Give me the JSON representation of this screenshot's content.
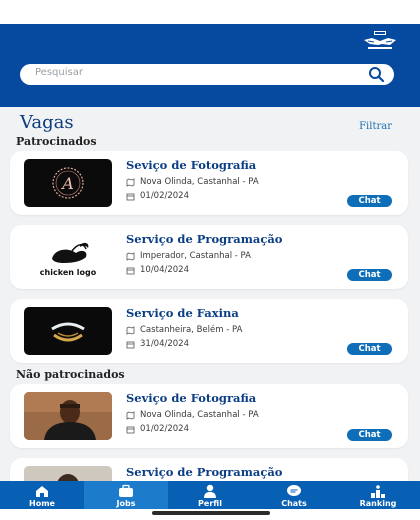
{
  "header": {
    "logo_icon": "handshake-logo-icon"
  },
  "search": {
    "placeholder": "Pesquisar",
    "icon": "search-icon"
  },
  "page": {
    "title": "Vagas",
    "filter_label": "Filtrar"
  },
  "sections": {
    "sponsored": "Patrocinados",
    "unsponsored": "Não patrocinados"
  },
  "cards": [
    {
      "title": "Seviço de Fotografia",
      "location": "Nova Olinda, Castanhal - PA",
      "date": "01/02/2024",
      "chat": "Chat",
      "thumb": "photography-logo"
    },
    {
      "title": "Serviço de Programação",
      "location": "Imperador, Castanhal - PA",
      "date": "10/04/2024",
      "chat": "Chat",
      "thumb": "chicken-logo",
      "thumb_text": "chicken logo"
    },
    {
      "title": "Serviço de Faxina",
      "location": "Castanheira, Belém - PA",
      "date": "31/04/2024",
      "chat": "Chat",
      "thumb": "cleaning-logo"
    },
    {
      "title": "Seviço de Fotografia",
      "location": "Nova Olinda, Castanhal - PA",
      "date": "01/02/2024",
      "chat": "Chat",
      "thumb": "person-photo"
    },
    {
      "title": "Serviço de Programação",
      "thumb": "person-photo"
    }
  ],
  "nav": [
    {
      "label": "Home",
      "icon": "home-icon"
    },
    {
      "label": "Jobs",
      "icon": "briefcase-icon",
      "active": true
    },
    {
      "label": "Perfil",
      "icon": "person-icon"
    },
    {
      "label": "Chats",
      "icon": "chat-icon"
    },
    {
      "label": "Ranking",
      "icon": "podium-icon"
    }
  ],
  "colors": {
    "primary": "#064aa0",
    "nav": "#0860b4",
    "title": "#0c3e84",
    "chat_button": "#0e6eb8",
    "background": "#f1f2f4"
  }
}
